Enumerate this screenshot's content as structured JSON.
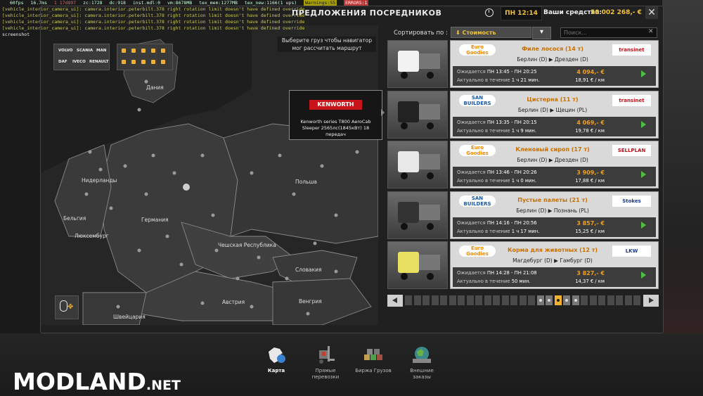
{
  "debug": {
    "fps": "60fps",
    "frame_ms": "16.7ms",
    "mem": "1 17d897",
    "zc": "zc:1728",
    "dc": "dc:918",
    "inst": "inst.mdl:0",
    "vm": "vm:8678MB",
    "tex_mem": "tex_mem:1277MB",
    "tex_new": "tex_new:1166(1 ups)",
    "warnings": "Warnings:55",
    "errors": "ERRORS:1",
    "log_lines": [
      "[vehicle_interior_camera_ui]: camera.interior.peterbilt.378 right rotation limit doesn't have defined override",
      "[vehicle_interior_camera_ui]: camera.interior.peterbilt.378 right rotation limit doesn't have defined override",
      "[vehicle_interior_camera_ui]: camera.interior.peterbilt.378 right rotation limit doesn't have defined override",
      "[vehicle_interior_camera_ui]: camera.interior.peterbilt.378 right rotation limit doesn't have defined override",
      "screenshot"
    ]
  },
  "header": {
    "title": "ПРЕДЛОЖЕНИЯ ПОСРЕДНИКОВ",
    "time": "ПН 12:14",
    "funds_label": "Ваши средства:",
    "funds_value": "50 002 268,- €",
    "close": "✕"
  },
  "map": {
    "hint": "Выберите груз чтобы навигатор мог рассчитать маршрут",
    "labels": {
      "denmark": "Дания",
      "netherlands": "Нидерланды",
      "belgium": "Бельгия",
      "luxembourg": "Люксембург",
      "germany": "Германия",
      "poland": "Польша",
      "czech": "Чешская Республика",
      "slovakia": "Словакия",
      "austria": "Австрия",
      "hungary": "Венгрия",
      "switzerland": "Швейцария"
    },
    "brands": {
      "volvo": "VOLVO",
      "scania": "SCANIA",
      "man": "MAN",
      "daf": "DAF",
      "iveco": "IVECO",
      "renault": "RENAULT"
    }
  },
  "tooltip": {
    "logo": "KENWORTH",
    "text": "Kenworth series T800 AeroCab Sleeper 2565лс(1845кВт) 18 передач"
  },
  "sort": {
    "label": "Сортировать по :",
    "value": "Стоимость",
    "search_placeholder": "Поиск..."
  },
  "offers": [
    {
      "sender": "Euro Goodies",
      "sender_color": "#f08a00",
      "cargo": "Филе лосося (14 т)",
      "route": "Берлин (D) ▶ Дрезден (D)",
      "receiver": "transinet",
      "receiver_color": "#c0101a",
      "expires_label": "Ожидается",
      "expires": "ПН 13:45 - ПН 20:25",
      "valid_label": "Актуально в течение",
      "valid": "1 ч 21 мин.",
      "price": "4 094,- €",
      "per_km": "18,91 € / км",
      "cab_color": "#f2f2f2"
    },
    {
      "sender": "SAN BUILDERS",
      "sender_color": "#1a5aa8",
      "cargo": "Цистерна (11 т)",
      "route": "Берлин (D) ▶ Щецин (PL)",
      "receiver": "transinet",
      "receiver_color": "#c0101a",
      "expires_label": "Ожидается",
      "expires": "ПН 13:35 - ПН 20:15",
      "valid_label": "Актуально в течение",
      "valid": "1 ч 9 мин.",
      "price": "4 069,- €",
      "per_km": "19,78 € / км",
      "cab_color": "#222222"
    },
    {
      "sender": "Euro Goodies",
      "sender_color": "#f08a00",
      "cargo": "Кленовый сироп (17 т)",
      "route": "Берлин (D) ▶ Дрезден (D)",
      "receiver": "SELLPLAN",
      "receiver_color": "#c0101a",
      "expires_label": "Ожидается",
      "expires": "ПН 13:46 - ПН 20:26",
      "valid_label": "Актуально в течение",
      "valid": "1 ч 0 мин.",
      "price": "3 909,- €",
      "per_km": "17,88 € / км",
      "cab_color": "#e8e8e8"
    },
    {
      "sender": "SAN BUILDERS",
      "sender_color": "#1a5aa8",
      "cargo": "Пустые палеты (21 т)",
      "route": "Берлин (D) ▶ Познань (PL)",
      "receiver": "Stokes",
      "receiver_color": "#1a3a8a",
      "expires_label": "Ожидается",
      "expires": "ПН 14:16 - ПН 20:56",
      "valid_label": "Актуально в течение",
      "valid": "1 ч 17 мин.",
      "price": "3 857,- €",
      "per_km": "15,25 € / км",
      "cab_color": "#333333"
    },
    {
      "sender": "Euro Goodies",
      "sender_color": "#f08a00",
      "cargo": "Корма для животных (12 т)",
      "route": "Магдебург (D) ▶ Гамбург (D)",
      "receiver": "LKW",
      "receiver_color": "#1a3a8a",
      "expires_label": "Ожидается",
      "expires": "ПН 14:28 - ПН 21:08",
      "valid_label": "Актуально в течение",
      "valid": "50 мин.",
      "price": "3 827,- €",
      "per_km": "14,37 € / км",
      "cab_color": "#e8e060"
    }
  ],
  "pager": {
    "pages": 27,
    "current": 17
  },
  "nav": [
    {
      "label": "Карта",
      "icon": "europe-map-icon",
      "active": true
    },
    {
      "label": "Прямые перевозки",
      "icon": "forklift-icon",
      "active": false
    },
    {
      "label": "Биржа Грузов",
      "icon": "cargo-exchange-icon",
      "active": false
    },
    {
      "label": "Внешние заказы",
      "icon": "globe-trailer-icon",
      "active": false
    }
  ],
  "watermark": {
    "main": "MODLAND",
    "suffix": ".NET"
  }
}
